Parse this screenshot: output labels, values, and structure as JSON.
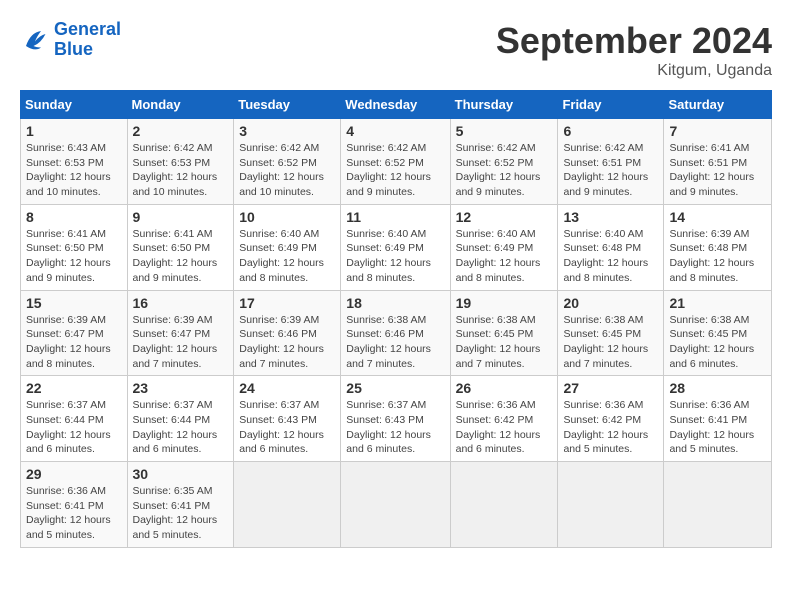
{
  "header": {
    "logo_line1": "General",
    "logo_line2": "Blue",
    "month_title": "September 2024",
    "location": "Kitgum, Uganda"
  },
  "days_of_week": [
    "Sunday",
    "Monday",
    "Tuesday",
    "Wednesday",
    "Thursday",
    "Friday",
    "Saturday"
  ],
  "weeks": [
    [
      {
        "day": "1",
        "sunrise": "6:43 AM",
        "sunset": "6:53 PM",
        "daylight": "12 hours and 10 minutes."
      },
      {
        "day": "2",
        "sunrise": "6:42 AM",
        "sunset": "6:53 PM",
        "daylight": "12 hours and 10 minutes."
      },
      {
        "day": "3",
        "sunrise": "6:42 AM",
        "sunset": "6:52 PM",
        "daylight": "12 hours and 10 minutes."
      },
      {
        "day": "4",
        "sunrise": "6:42 AM",
        "sunset": "6:52 PM",
        "daylight": "12 hours and 9 minutes."
      },
      {
        "day": "5",
        "sunrise": "6:42 AM",
        "sunset": "6:52 PM",
        "daylight": "12 hours and 9 minutes."
      },
      {
        "day": "6",
        "sunrise": "6:42 AM",
        "sunset": "6:51 PM",
        "daylight": "12 hours and 9 minutes."
      },
      {
        "day": "7",
        "sunrise": "6:41 AM",
        "sunset": "6:51 PM",
        "daylight": "12 hours and 9 minutes."
      }
    ],
    [
      {
        "day": "8",
        "sunrise": "6:41 AM",
        "sunset": "6:50 PM",
        "daylight": "12 hours and 9 minutes."
      },
      {
        "day": "9",
        "sunrise": "6:41 AM",
        "sunset": "6:50 PM",
        "daylight": "12 hours and 9 minutes."
      },
      {
        "day": "10",
        "sunrise": "6:40 AM",
        "sunset": "6:49 PM",
        "daylight": "12 hours and 8 minutes."
      },
      {
        "day": "11",
        "sunrise": "6:40 AM",
        "sunset": "6:49 PM",
        "daylight": "12 hours and 8 minutes."
      },
      {
        "day": "12",
        "sunrise": "6:40 AM",
        "sunset": "6:49 PM",
        "daylight": "12 hours and 8 minutes."
      },
      {
        "day": "13",
        "sunrise": "6:40 AM",
        "sunset": "6:48 PM",
        "daylight": "12 hours and 8 minutes."
      },
      {
        "day": "14",
        "sunrise": "6:39 AM",
        "sunset": "6:48 PM",
        "daylight": "12 hours and 8 minutes."
      }
    ],
    [
      {
        "day": "15",
        "sunrise": "6:39 AM",
        "sunset": "6:47 PM",
        "daylight": "12 hours and 8 minutes."
      },
      {
        "day": "16",
        "sunrise": "6:39 AM",
        "sunset": "6:47 PM",
        "daylight": "12 hours and 7 minutes."
      },
      {
        "day": "17",
        "sunrise": "6:39 AM",
        "sunset": "6:46 PM",
        "daylight": "12 hours and 7 minutes."
      },
      {
        "day": "18",
        "sunrise": "6:38 AM",
        "sunset": "6:46 PM",
        "daylight": "12 hours and 7 minutes."
      },
      {
        "day": "19",
        "sunrise": "6:38 AM",
        "sunset": "6:45 PM",
        "daylight": "12 hours and 7 minutes."
      },
      {
        "day": "20",
        "sunrise": "6:38 AM",
        "sunset": "6:45 PM",
        "daylight": "12 hours and 7 minutes."
      },
      {
        "day": "21",
        "sunrise": "6:38 AM",
        "sunset": "6:45 PM",
        "daylight": "12 hours and 6 minutes."
      }
    ],
    [
      {
        "day": "22",
        "sunrise": "6:37 AM",
        "sunset": "6:44 PM",
        "daylight": "12 hours and 6 minutes."
      },
      {
        "day": "23",
        "sunrise": "6:37 AM",
        "sunset": "6:44 PM",
        "daylight": "12 hours and 6 minutes."
      },
      {
        "day": "24",
        "sunrise": "6:37 AM",
        "sunset": "6:43 PM",
        "daylight": "12 hours and 6 minutes."
      },
      {
        "day": "25",
        "sunrise": "6:37 AM",
        "sunset": "6:43 PM",
        "daylight": "12 hours and 6 minutes."
      },
      {
        "day": "26",
        "sunrise": "6:36 AM",
        "sunset": "6:42 PM",
        "daylight": "12 hours and 6 minutes."
      },
      {
        "day": "27",
        "sunrise": "6:36 AM",
        "sunset": "6:42 PM",
        "daylight": "12 hours and 5 minutes."
      },
      {
        "day": "28",
        "sunrise": "6:36 AM",
        "sunset": "6:41 PM",
        "daylight": "12 hours and 5 minutes."
      }
    ],
    [
      {
        "day": "29",
        "sunrise": "6:36 AM",
        "sunset": "6:41 PM",
        "daylight": "12 hours and 5 minutes."
      },
      {
        "day": "30",
        "sunrise": "6:35 AM",
        "sunset": "6:41 PM",
        "daylight": "12 hours and 5 minutes."
      },
      null,
      null,
      null,
      null,
      null
    ]
  ]
}
